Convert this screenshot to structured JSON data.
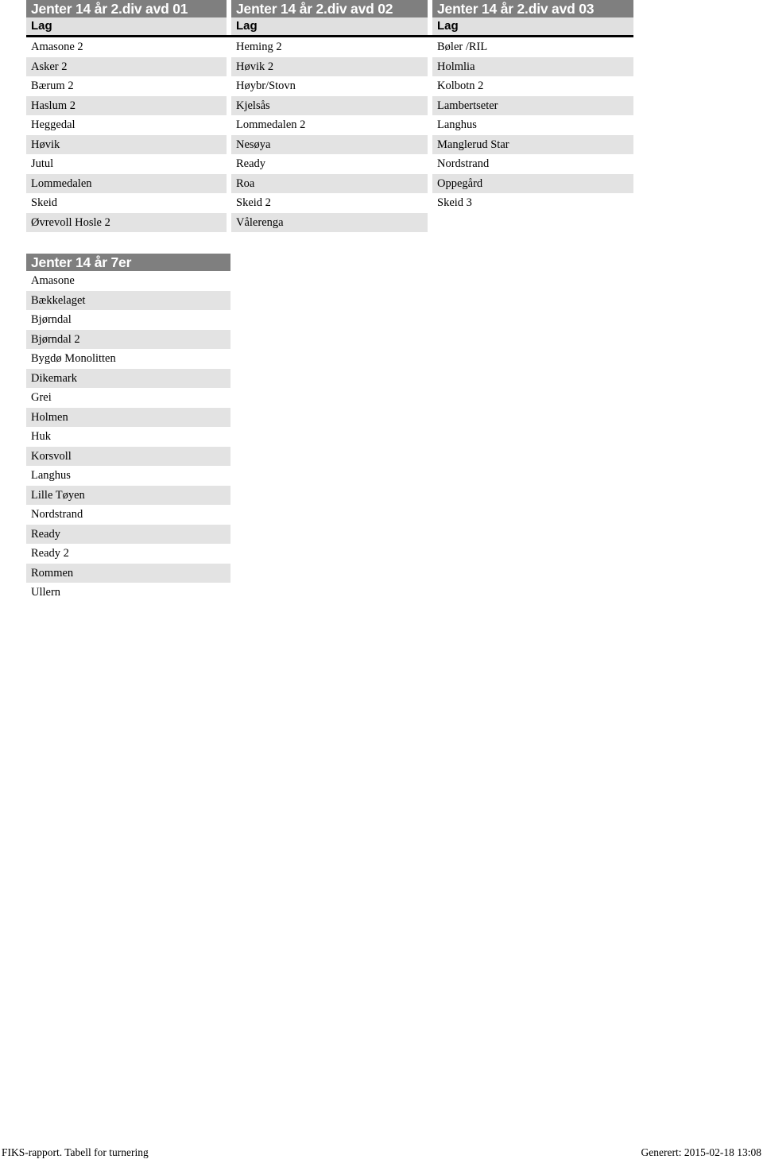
{
  "document": {
    "type": "FIKS tournament table report"
  },
  "table1": {
    "columns": [
      {
        "title": "Jenter 14 år 2.div avd 01",
        "header": "Lag",
        "teams": [
          "Amasone  2",
          "Asker 2",
          "Bærum 2",
          "Haslum 2",
          "Heggedal",
          "Høvik",
          "Jutul",
          "Lommedalen",
          "Skeid",
          "Øvrevoll Hosle 2"
        ]
      },
      {
        "title": "Jenter 14 år 2.div avd 02",
        "header": "Lag",
        "teams": [
          "Heming 2",
          "Høvik 2",
          "Høybr/Stovn",
          "Kjelsås",
          "Lommedalen 2",
          "Nesøya",
          "Ready",
          "Roa",
          "Skeid 2",
          "Vålerenga"
        ]
      },
      {
        "title": "Jenter 14 år 2.div avd 03",
        "header": "Lag",
        "teams": [
          "Bøler /RIL",
          "Holmlia",
          "Kolbotn 2",
          "Lambertseter",
          "Langhus",
          "Manglerud Star",
          "Nordstrand",
          "Oppegård",
          "Skeid 3",
          ""
        ]
      }
    ]
  },
  "table2": {
    "title": "Jenter 14 år 7er",
    "teams": [
      "Amasone",
      "Bækkelaget",
      "Bjørndal",
      "Bjørndal 2",
      "Bygdø Monolitten",
      "Dikemark",
      "Grei",
      "Holmen",
      "Huk",
      "Korsvoll",
      "Langhus",
      "Lille Tøyen",
      "Nordstrand",
      "Ready",
      "Ready 2",
      "Rommen",
      "Ullern"
    ]
  },
  "footer": {
    "left": "FIKS-rapport. Tabell for turnering",
    "right": "Generert: 2015-02-18 13:08"
  },
  "colors": {
    "header_band": "#7f7f7f",
    "subheader_band": "#e0e0e0",
    "row_band": "#e3e3e3",
    "rule": "#000000",
    "page_background": "#ffffff"
  }
}
